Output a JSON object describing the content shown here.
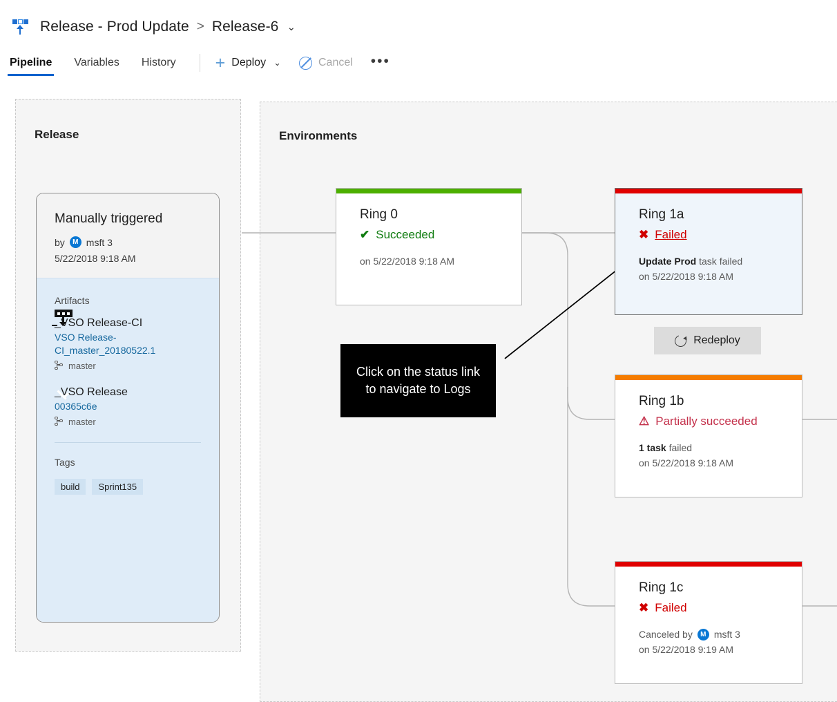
{
  "header": {
    "icon": "release-icon",
    "breadcrumb_root": "Release - Prod Update",
    "breadcrumb_separator": ">",
    "breadcrumb_current": "Release-6",
    "breadcrumb_chevron": "⌄",
    "tabs": [
      {
        "label": "Pipeline",
        "active": true
      },
      {
        "label": "Variables",
        "active": false
      },
      {
        "label": "History",
        "active": false
      }
    ],
    "commands": {
      "deploy_label": "Deploy",
      "deploy_plus": "+",
      "deploy_chevron": "⌄",
      "cancel_label": "Cancel",
      "cancel_icon": "block-icon",
      "more_label": "•••"
    }
  },
  "release_panel": {
    "title": "Release",
    "card": {
      "trigger": "Manually triggered",
      "by_label": "by",
      "avatar_initial": "M",
      "user": "msft 3",
      "timestamp": "5/22/2018 9:18 AM",
      "artifacts_label": "Artifacts",
      "artifacts": [
        {
          "icon": "build-artifact-icon",
          "name": "_VSO Release-CI",
          "version": "VSO Release-CI_master_20180522.1",
          "branch": "master"
        },
        {
          "icon": "git-repo-icon",
          "name": "_VSO Release",
          "version": "00365c6e",
          "branch": "master"
        }
      ],
      "tags_label": "Tags",
      "tags": [
        "build",
        "Sprint135"
      ]
    }
  },
  "environments_panel": {
    "title": "Environments",
    "cards": [
      {
        "id": "ring0",
        "name": "Ring 0",
        "status": "Succeeded",
        "status_glyph": "✔",
        "status_kind": "succeeded",
        "status_is_link": false,
        "bar_color": "#4caf00",
        "detail_bold": "",
        "detail_rest": "",
        "detail_line2": "on 5/22/2018 9:18 AM",
        "selected": false,
        "canceled_by": null
      },
      {
        "id": "ring1a",
        "name": "Ring 1a",
        "status": "Failed",
        "status_glyph": "✖",
        "status_kind": "failed",
        "status_is_link": true,
        "bar_color": "#e00000",
        "detail_bold": "Update Prod",
        "detail_rest": " task failed",
        "detail_line2": "on 5/22/2018 9:18 AM",
        "selected": true,
        "canceled_by": null
      },
      {
        "id": "ring1b",
        "name": "Ring 1b",
        "status": "Partially succeeded",
        "status_glyph": "⚠",
        "status_kind": "partial",
        "status_is_link": false,
        "bar_color": "#f57c00",
        "detail_bold": "1 task",
        "detail_rest": " failed",
        "detail_line2": "on 5/22/2018 9:18 AM",
        "selected": false,
        "canceled_by": null
      },
      {
        "id": "ring1c",
        "name": "Ring 1c",
        "status": "Failed",
        "status_glyph": "✖",
        "status_kind": "failed",
        "status_is_link": false,
        "bar_color": "#e00000",
        "detail_bold": "",
        "detail_rest": "",
        "detail_line2": "on 5/22/2018 9:19 AM",
        "selected": false,
        "canceled_by": {
          "prefix": "Canceled by",
          "avatar_initial": "M",
          "user": "msft 3"
        }
      }
    ],
    "redeploy_button": {
      "label": "Redeploy",
      "icon": "redeploy-icon"
    }
  },
  "callout": {
    "text": "Click on the status link to navigate to Logs"
  }
}
